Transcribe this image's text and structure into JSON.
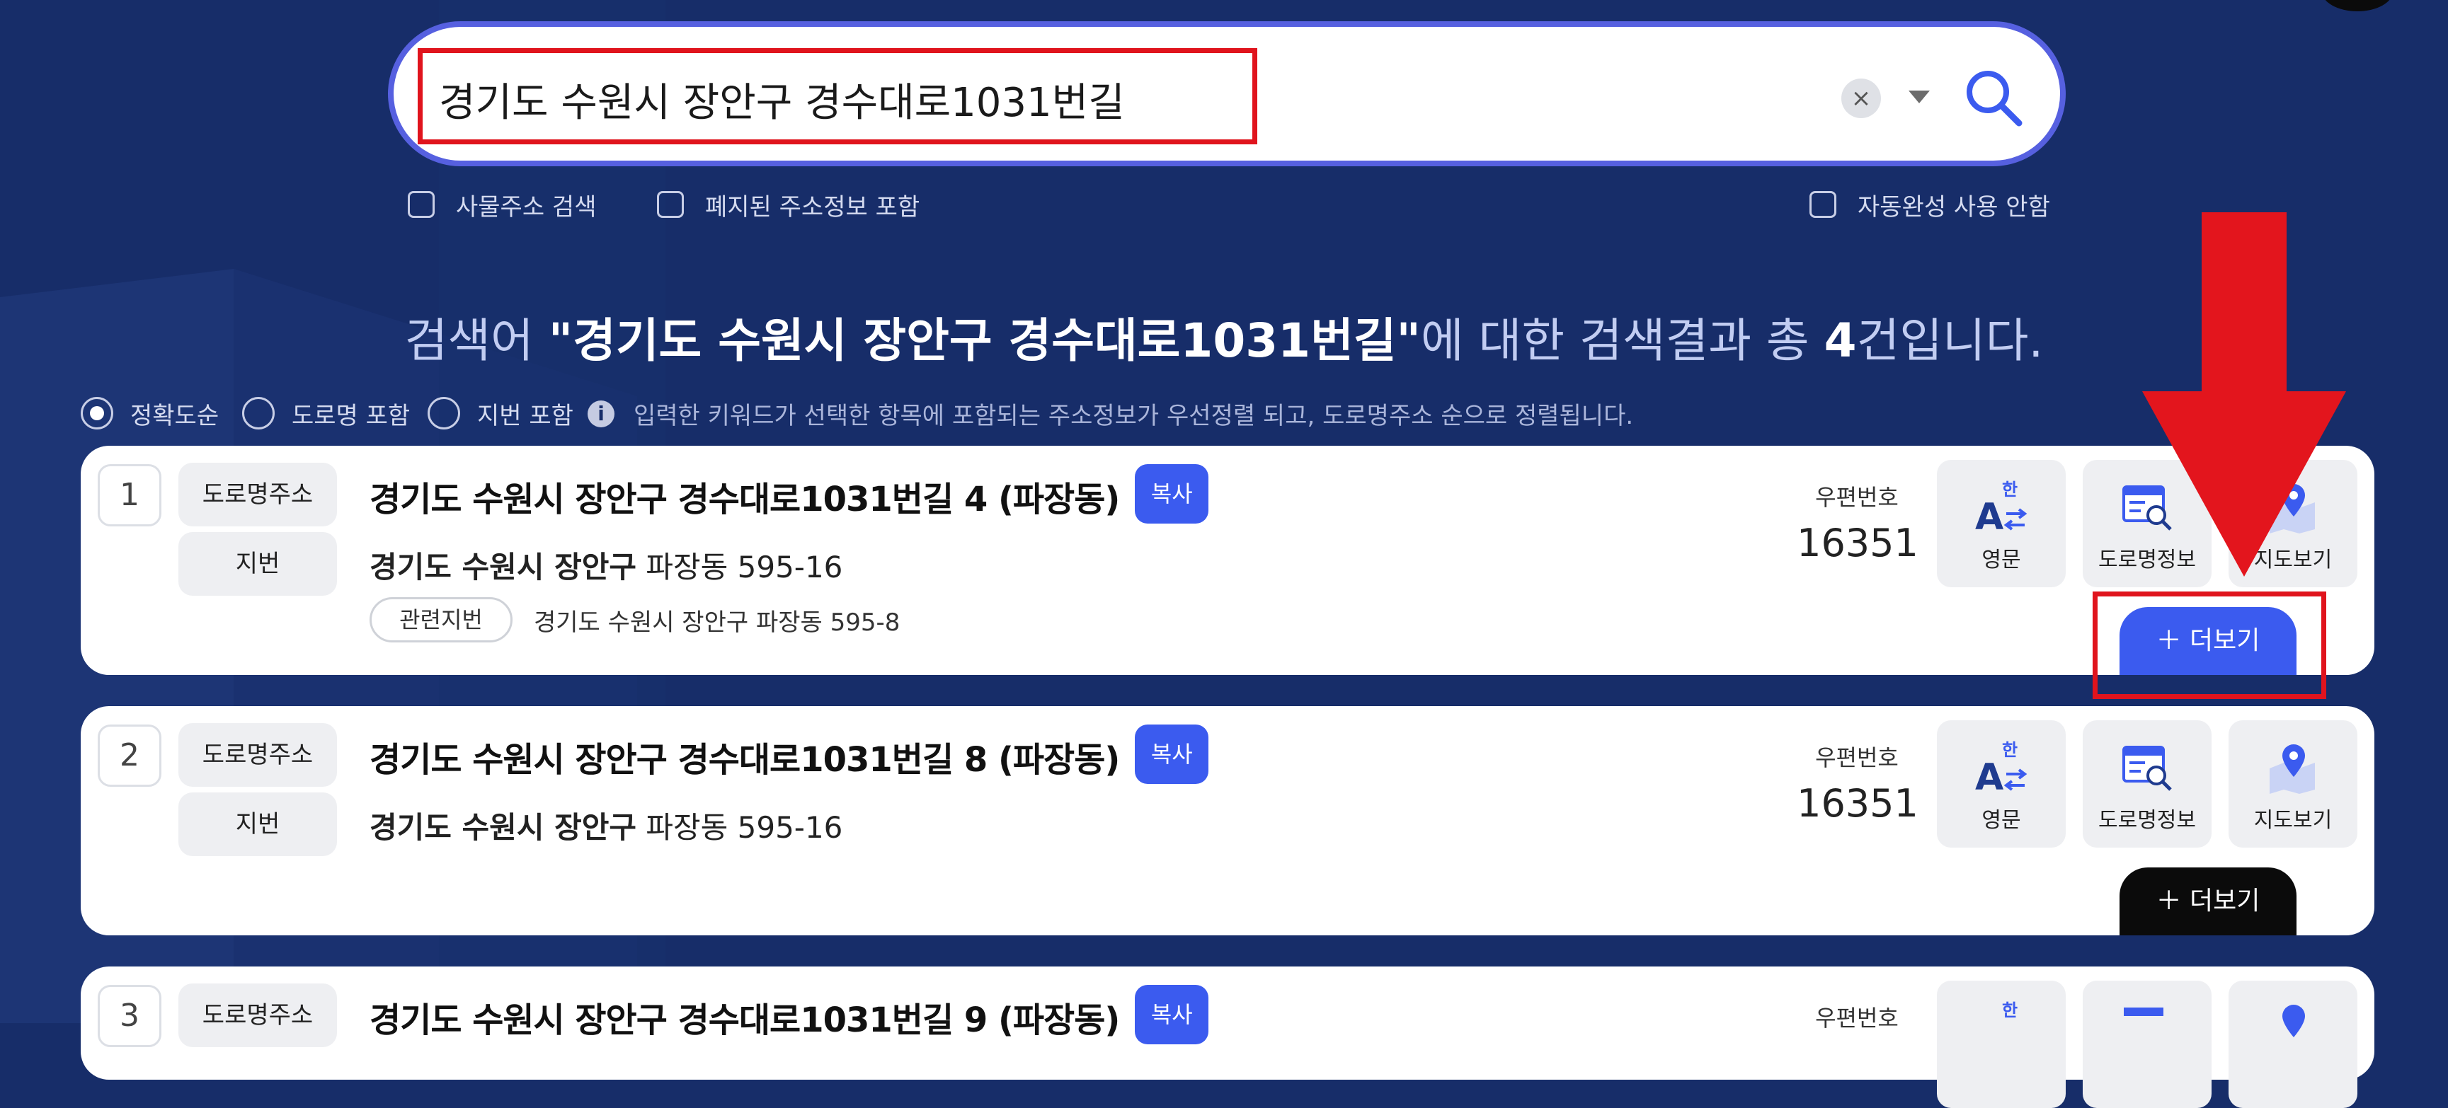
{
  "search": {
    "query": "경기도 수원시 장안구 경수대로1031번길",
    "clear_label": "×"
  },
  "options": {
    "building_search": "사물주소 검색",
    "include_abolished": "폐지된 주소정보 포함",
    "disable_autocomplete": "자동완성 사용 안함"
  },
  "summary": {
    "prefix": "검색어 ",
    "query": "\"경기도 수원시 장안구 경수대로1031번길\"",
    "middle": "에 대한 검색결과 총 ",
    "count": "4",
    "suffix": "건입니다."
  },
  "sort": {
    "accuracy": "정확도순",
    "road_included": "도로명 포함",
    "lot_included": "지번 포함",
    "info_icon": "i",
    "note": "입력한 키워드가 선택한 항목에 포함되는 주소정보가 우선정렬 되고, 도로명주소 순으로 정렬됩니다."
  },
  "labels": {
    "road_tag": "도로명주소",
    "lot_tag": "지번",
    "copy": "복사",
    "zip_label": "우편번호",
    "related_lot": "관련지번",
    "tool_english": "영문",
    "tool_roadinfo": "도로명정보",
    "tool_map": "지도보기",
    "more": "＋ 더보기",
    "english_glyph_top": "한",
    "english_glyph_main": "A"
  },
  "results": [
    {
      "index": "1",
      "road_address": "경기도 수원시 장안구 경수대로1031번길 4 (파장동)",
      "lot_region": "경기도 수원시 장안구",
      "lot_detail": " 파장동 595-16",
      "related_lot": "경기도 수원시 장안구 파장동 595-8",
      "zipcode": "16351"
    },
    {
      "index": "2",
      "road_address": "경기도 수원시 장안구 경수대로1031번길 8 (파장동)",
      "lot_region": "경기도 수원시 장안구",
      "lot_detail": " 파장동 595-16",
      "zipcode": "16351"
    },
    {
      "index": "3",
      "road_address": "경기도 수원시 장안구 경수대로1031번길 9 (파장동)",
      "zipcode": ""
    }
  ],
  "colors": {
    "background": "#172d69",
    "accent": "#3b5bef",
    "highlight": "#e0141d",
    "more_active": "#3b5bef",
    "more_default": "#0b0b0b"
  }
}
